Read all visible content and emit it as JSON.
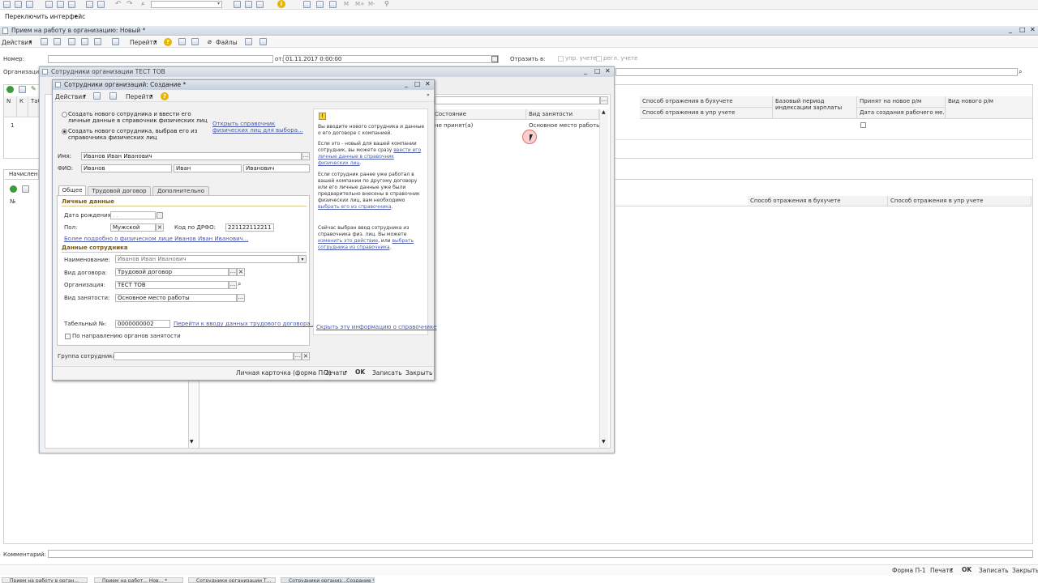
{
  "toolbar_top": {
    "interface_switch": "Переключить интерфейс"
  },
  "main_window": {
    "title": "Прием на работу в организацию: Новый *",
    "actions": "Действия",
    "goto": "Перейти",
    "files": "Файлы",
    "number_label": "Номер:",
    "number_value": "",
    "from_label": "от:",
    "date_value": "01.11.2017 0:00:00",
    "reflect_label": "Отразить в:",
    "reflect_mgmt": "упр. учете",
    "reflect_reg": "регл. учете",
    "org_label": "Организация:",
    "grid_cols": [
      "N",
      "К",
      "Таб",
      "Состояние",
      "Вид занятости",
      "Способ отражения в бухучете",
      "Базовый период индексации зарплаты",
      "Принят на новое р/м",
      "Вид нового р/м"
    ],
    "grid_cols2": [
      "Способ отражения в упр учете",
      "Дата создания рабочего ме..."
    ],
    "grid_row": {
      "n": "1",
      "state": "не принят(а)",
      "employment": "Основное место работы"
    },
    "accruals_tab": "Начислени",
    "lower_cols": {
      "num": "№",
      "buh": "Способ отражения в бухучете",
      "upr": "Способ отражения в упр учете"
    },
    "comment_label": "Комментарий:",
    "bottom": {
      "form": "Форма П-1",
      "print": "Печать",
      "ok": "OK",
      "save": "Записать",
      "close": "Закрыть"
    }
  },
  "list_window": {
    "title": "Сотрудники организации ТЕСТ ТОВ"
  },
  "create_window": {
    "title": "Сотрудники организаций: Создание *",
    "actions": "Действия",
    "goto": "Перейти",
    "radio1": "Создать нового сотрудника и ввести его личные данные в справочник физических лиц",
    "radio2": "Создать нового сотрудника, выбрав его из справочника физических лиц",
    "open_ref_link": "Открыть справочник физических лиц для выбора...",
    "name_label": "Имя:",
    "name_value": "Иванов Иван Иванович",
    "fio_label": "ФИО:",
    "last_name": "Иванов",
    "first_name": "Иван",
    "middle_name": "Иванович",
    "tabs": [
      "Общее",
      "Трудовой договор",
      "Дополнительно"
    ],
    "personal_section": "Личные данные",
    "birth_label": "Дата рождения:",
    "birth_value": ". .",
    "sex_label": "Пол:",
    "sex_value": "Мужской",
    "tax_label": "Код по ДРФО:",
    "tax_value": "221122112211",
    "more_link": "Более подробно о физическом лице Иванов Иван Иванович...",
    "employee_section": "Данные сотрудника",
    "title_label": "Наименование:",
    "title_value": "Иванов Иван Иванович",
    "contract_label": "Вид договора:",
    "contract_value": "Трудовой договор",
    "org_label": "Организация:",
    "org_value": "ТЕСТ ТОВ",
    "employment_label": "Вид занятости:",
    "employment_value": "Основное место работы",
    "tabnum_label": "Табельный №:",
    "tabnum_value": "0000000002",
    "contract_link": "Перейти к вводу данных трудового договора...",
    "direction_label": "По направлению органов занятости",
    "group_label": "Группа сотрудника:",
    "bottom": {
      "card": "Личная карточка (форма П-2)",
      "print": "Печать",
      "ok": "OK",
      "save": "Записать",
      "close": "Закрыть"
    },
    "info": {
      "p1": "Вы вводите нового сотрудника и данные о его договоре с компанией.",
      "p2a": "Если это - новый для вашей компании сотрудник, вы можете сразу",
      "p2link": "ввести его личные данные в справочник физических лиц",
      "p3a": "Если сотрудник ранее уже работал в вашей компании по другому договору или его личные данные уже были предварительно внесены в справочник физических лиц, вам необходимо",
      "p3link": "выбрать его из справочника",
      "p4a": "Сейчас выбран ввод сотрудника из справочника физ. лиц. Вы можете",
      "p4link1": "изменить это действие",
      "p4mid": ", или",
      "p4link2": "выбрать сотрудника из справочника",
      "hide_link": "Скрыть эту информацию о справочнике"
    }
  },
  "taskbar": [
    "Прием на работу в орган...",
    "Прием на работ... Нов... *",
    "Сотрудники организации Т...",
    "Сотрудники организ...Создание *"
  ]
}
